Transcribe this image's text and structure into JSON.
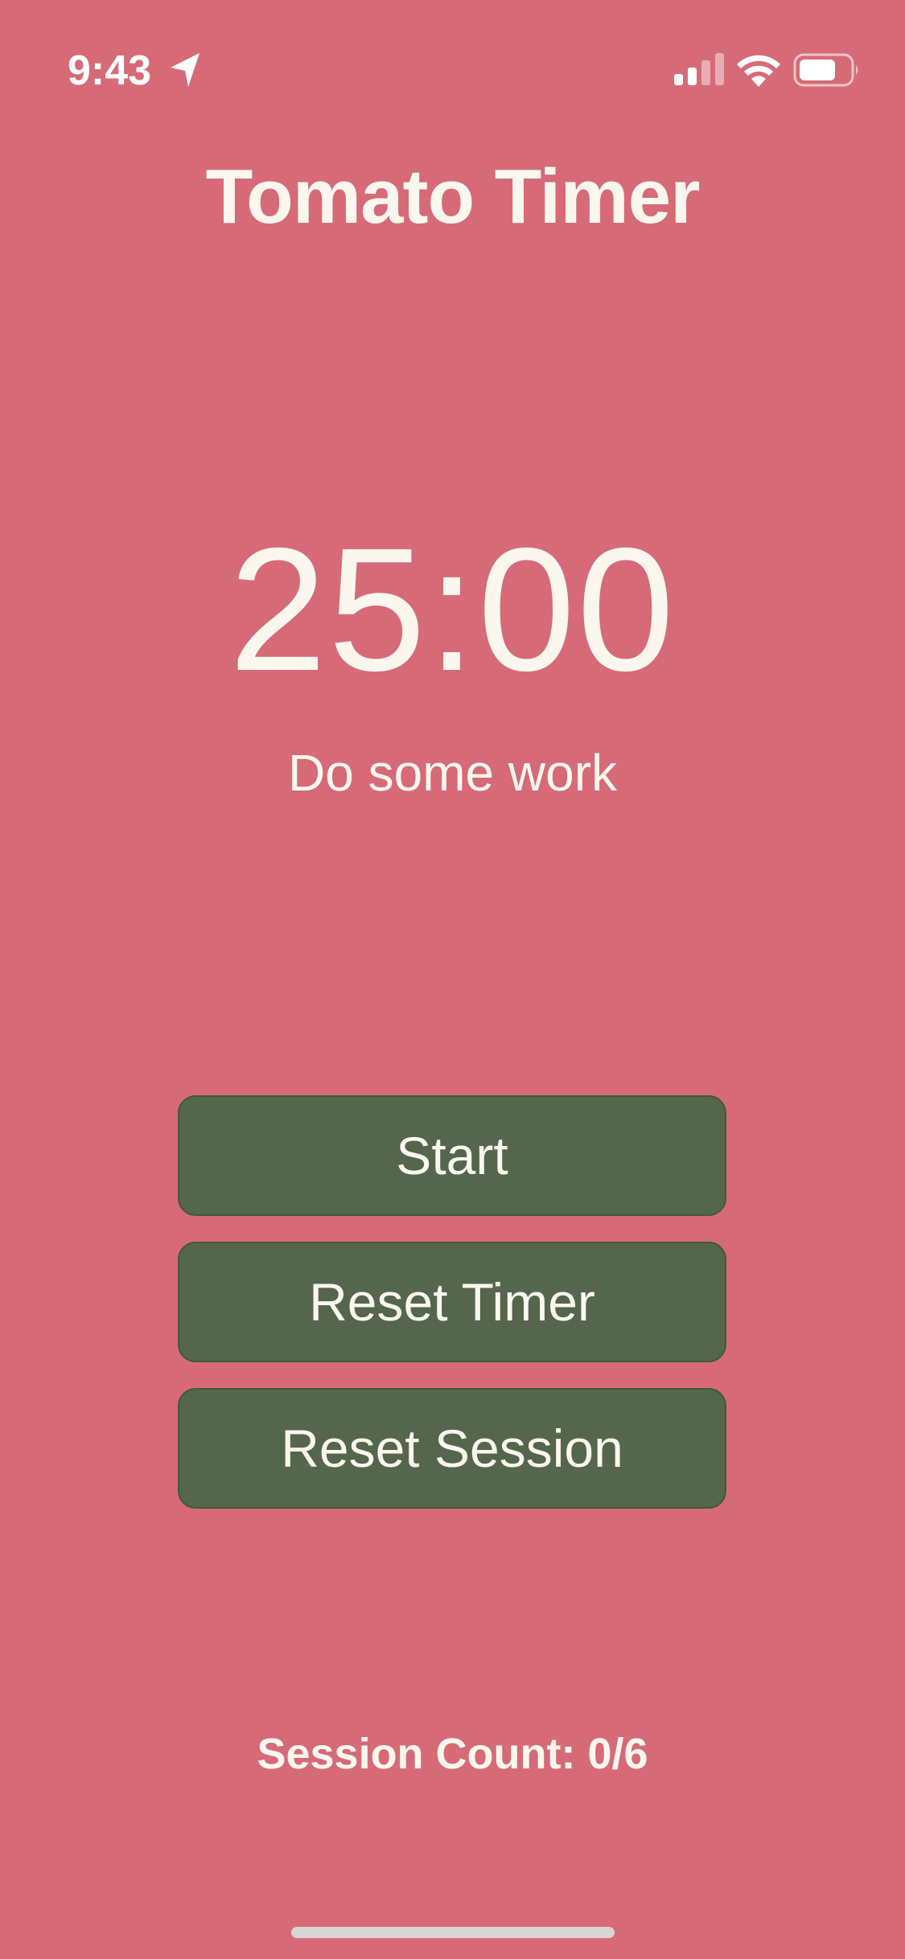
{
  "status_bar": {
    "time": "9:43",
    "icons": [
      "location-arrow-icon",
      "cellular-signal-icon",
      "wifi-icon",
      "battery-icon"
    ]
  },
  "app": {
    "title": "Tomato Timer"
  },
  "timer": {
    "time_display": "25:00",
    "subtitle": "Do some work"
  },
  "buttons": {
    "start_label": "Start",
    "reset_timer_label": "Reset Timer",
    "reset_session_label": "Reset Session"
  },
  "session": {
    "count_label": "Session Count: 0/6"
  },
  "colors": {
    "background": "#d66b77",
    "button_fill": "#54664b",
    "button_border": "#3f5a3a",
    "text": "#fbf7ef"
  }
}
